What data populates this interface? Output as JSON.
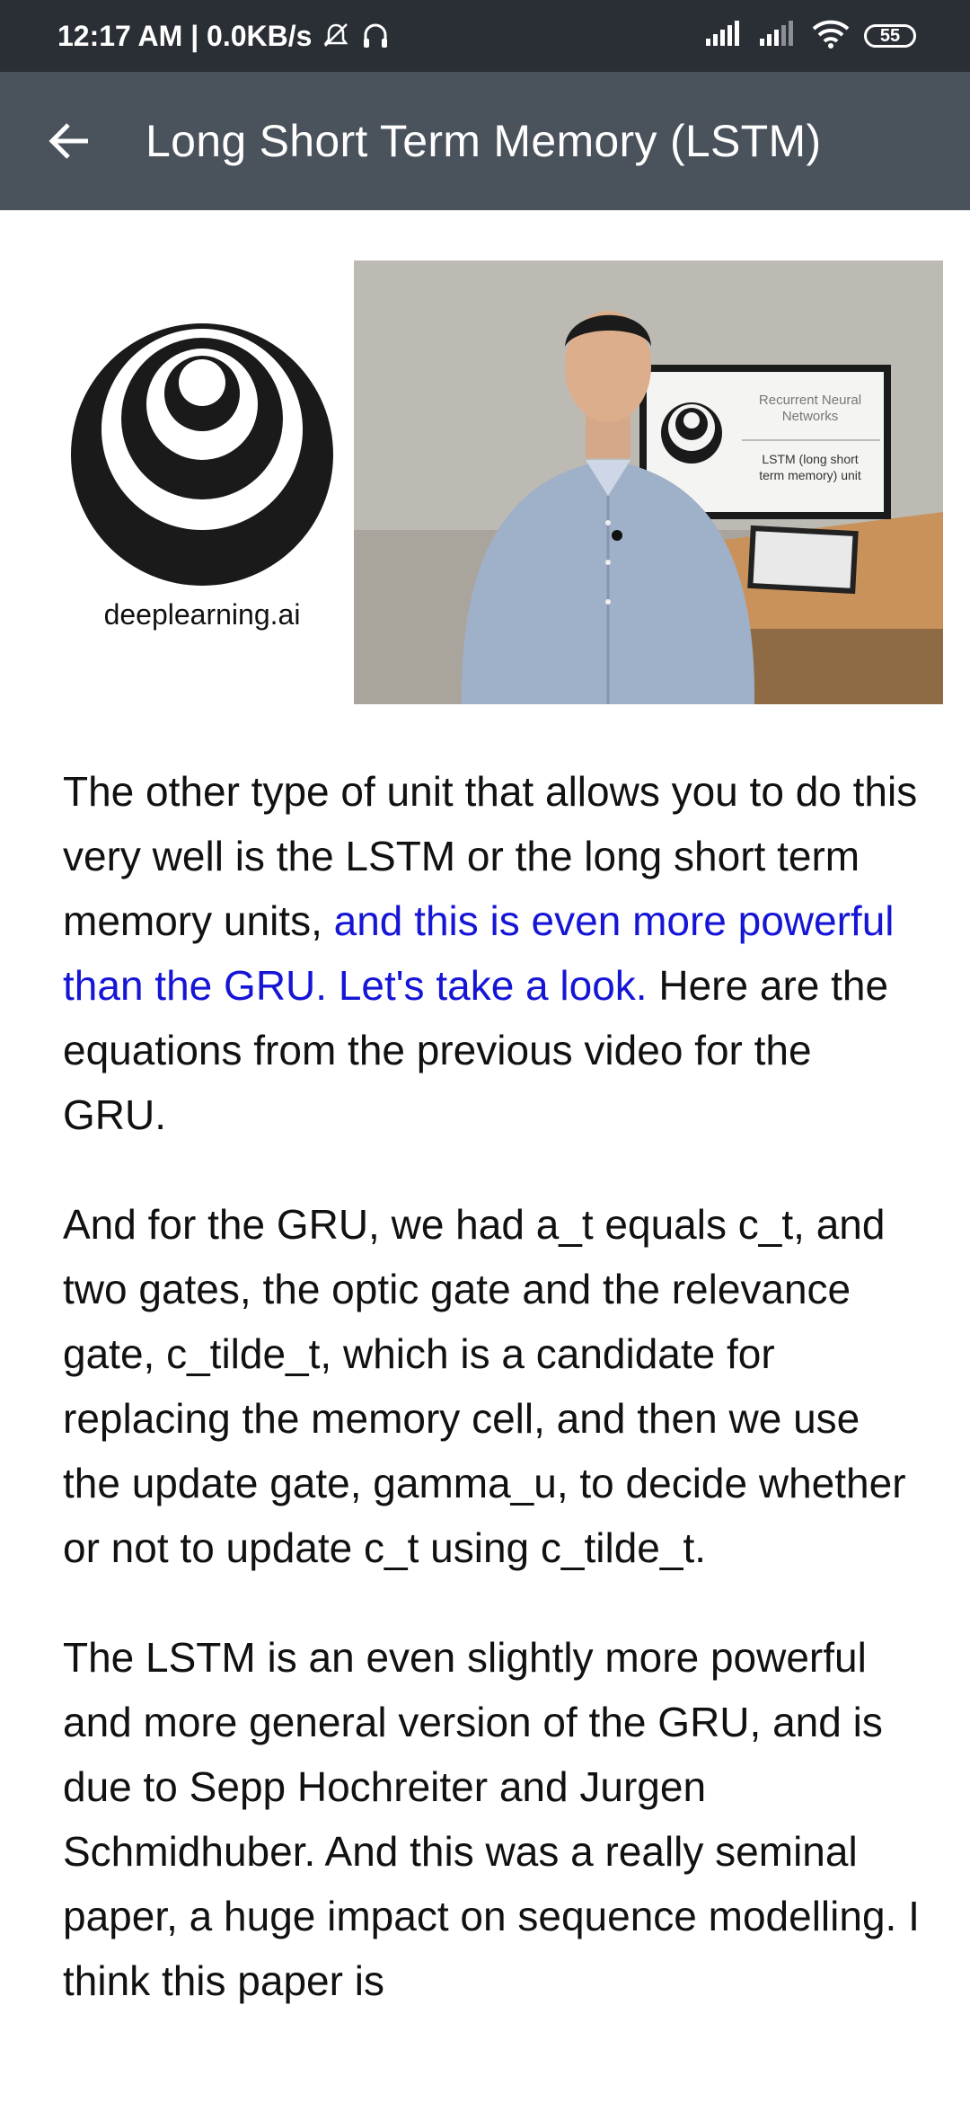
{
  "status_bar": {
    "time_speed": "12:17 AM | 0.0KB/s",
    "battery": "55"
  },
  "app_bar": {
    "title": "Long Short Term Memory (LSTM)"
  },
  "hero": {
    "logo_caption": "deeplearning.ai",
    "screen_title": "Recurrent Neural Networks",
    "screen_subtitle": "LSTM (long short term memory) unit"
  },
  "content": {
    "p1_a": "The other type of unit that allows you to do this very well is the LSTM or the long short term memory units, ",
    "p1_highlight": "and this is even more powerful than the GRU.  Let's take a look.",
    "p1_b": " Here are the equations from the previous video for the GRU.",
    "p2": "And for the GRU, we had a_t equals c_t, and two gates, the optic gate and the relevance gate, c_tilde_t, which is a candidate for replacing the memory cell, and then we use the update gate, gamma_u, to decide whether or not to update c_t using c_tilde_t.",
    "p3": "The LSTM is an even slightly more powerful and more general version of the GRU, and is due to Sepp Hochreiter and Jurgen Schmidhuber. And this was a really seminal paper, a huge impact on sequence modelling. I think this paper is"
  }
}
